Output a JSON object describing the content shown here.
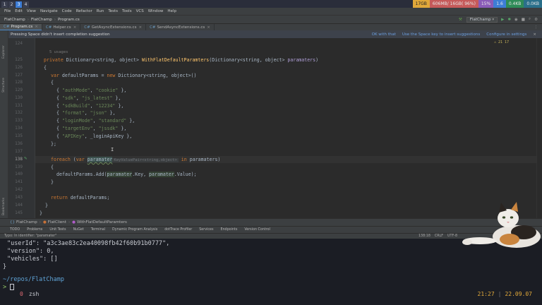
{
  "topbar": {
    "workspaces": [
      "1",
      "2",
      "3",
      "4"
    ],
    "active_workspace": "3",
    "stats": [
      "17GB",
      "606MB/ 16GB( 96%)",
      "15%",
      "1.6",
      "0.4KB",
      "0.0KB"
    ]
  },
  "menubar": [
    "File",
    "Edit",
    "View",
    "Navigate",
    "Code",
    "Refactor",
    "Run",
    "Tests",
    "Tools",
    "VCS",
    "Window",
    "Help"
  ],
  "navbar": {
    "breadcrumb": [
      "FlatChamp",
      "FlatChamp",
      "Program.cs"
    ],
    "run_config": "FlatChamp"
  },
  "tabs": [
    "Program.cs",
    "Helper.cs",
    "GetAsyncExtensions.cs",
    "SendAsyncExtensions.cs"
  ],
  "active_tab": "Program.cs",
  "notice": {
    "message": "Pressing Space didn't insert completion suggestion",
    "actions": [
      "OK with that",
      "Use the Space key to insert suggestions",
      "Configure in settings"
    ]
  },
  "leftstrip_labels": [
    "Explorer",
    "Structure",
    "Bookmarks"
  ],
  "editor": {
    "inspections": "21  17",
    "usages": "5 usages",
    "line_numbers": [
      "124",
      "125",
      "126",
      "127",
      "128",
      "129",
      "130",
      "131",
      "132",
      "133",
      "134",
      "135",
      "136",
      "137",
      "138",
      "139",
      "140",
      "141",
      "142",
      "143",
      "144",
      "145"
    ],
    "lines": {
      "l125_kw": "private",
      "l125_type": "Dictionary<string, object>",
      "l125_name": "WithFlatDefaultParamters",
      "l125_args": "(Dictionary<string, object> ",
      "l125_param": "paramaters",
      "l125_close": ")",
      "l126": "{",
      "l127_kw": "var",
      "l127_mid": " defaultParams = ",
      "l127_new": "new",
      "l127_end": " Dictionary<string, object>()",
      "l128": "{",
      "pairs": [
        {
          "k": "\"authMode\"",
          "v": "\"cookie\""
        },
        {
          "k": "\"sdk\"",
          "v": "\"js_latest\""
        },
        {
          "k": "\"sdkBuild\"",
          "v": "\"12234\""
        },
        {
          "k": "\"format\"",
          "v": "\"json\""
        },
        {
          "k": "\"loginMode\"",
          "v": "\"standard\""
        },
        {
          "k": "\"targetEnv\"",
          "v": "\"jssdk\""
        }
      ],
      "l135_k": "\"APIKey\"",
      "l135_v": "_loginApiKey",
      "l136": "};",
      "l138_kw": "foreach",
      "l138_var": "var",
      "l138_ident": "paramater",
      "l138_hint": "KeyValuePair<string,object>",
      "l138_in": "in",
      "l138_tail": "paramaters)",
      "l139": "{",
      "l140_a": "defaultParams.Add(",
      "l140_b": "paramater",
      "l140_c": ".Key, ",
      "l140_d": "paramater",
      "l140_e": ".Value);",
      "l141": "}",
      "l143_kw": "return",
      "l143_rest": " defaultParams;",
      "l144": "}",
      "l145": "}"
    }
  },
  "breadcrumbs_bottom": [
    "FlatChamp",
    "FlatClient",
    "WithFlatDefaultParamters"
  ],
  "toolwindows": [
    "TODO",
    "Problems",
    "Unit Tests",
    "NuGet",
    "Terminal",
    "Dynamic Program Analysis",
    "dotTrace Profiler",
    "Services",
    "Endpoints",
    "Version Control"
  ],
  "status": {
    "message": "Typo: In identifier: \"paramater\"",
    "position": "138:18",
    "line_sep": "CRLF",
    "encoding": "UTF-8"
  },
  "terminal": {
    "lines": [
      "\"userId\": \"a3c3ae83c2ea40098fb42f60b91b0777\",",
      "\"version\": 0,",
      "\"vehicles\": []",
      "}"
    ],
    "path": "~/repos/FlatChamp",
    "prompt": ">",
    "tab_index": "0",
    "tab_name": "zsh",
    "time": "21:27",
    "date": "22.09.07"
  },
  "colors": {
    "accent": "#3d7dd6",
    "keyword": "#cc7832",
    "string": "#6a8759",
    "function": "#ffc66d"
  }
}
